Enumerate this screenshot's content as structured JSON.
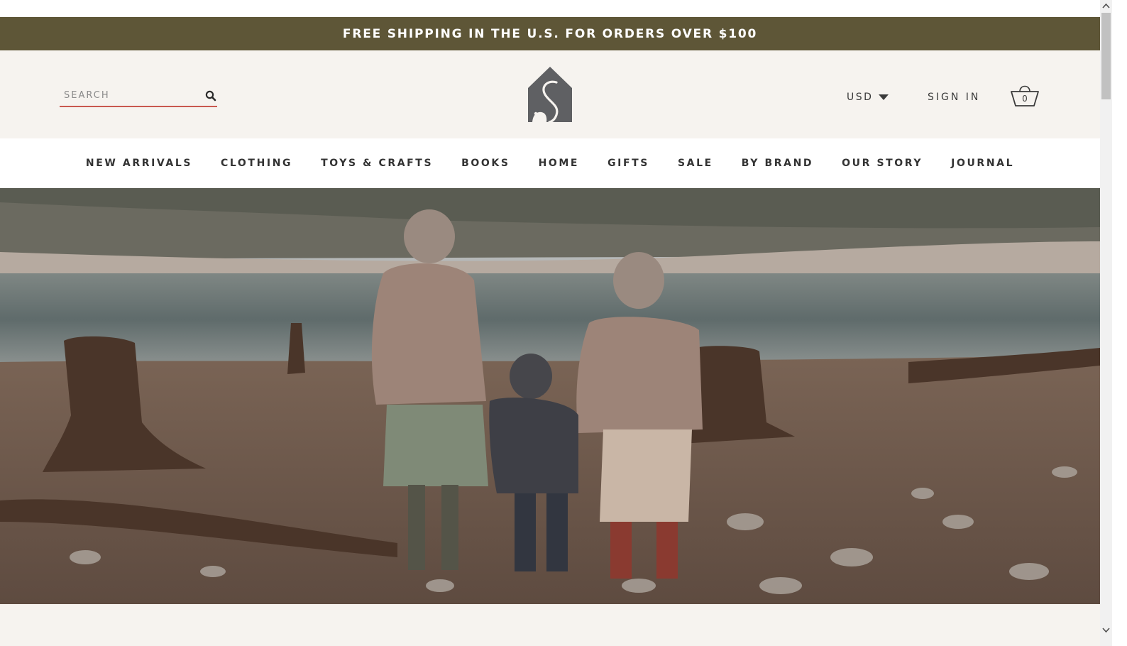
{
  "promo_bar": {
    "text": "FREE SHIPPING IN THE U.S. FOR ORDERS OVER $100"
  },
  "header": {
    "search": {
      "placeholder": "SEARCH",
      "value": ""
    },
    "currency": {
      "selected": "USD"
    },
    "sign_in_label": "SIGN IN",
    "cart_count": "0"
  },
  "nav": {
    "items": [
      {
        "label": "NEW ARRIVALS"
      },
      {
        "label": "CLOTHING"
      },
      {
        "label": "TOYS & CRAFTS"
      },
      {
        "label": "BOOKS"
      },
      {
        "label": "HOME"
      },
      {
        "label": "GIFTS"
      },
      {
        "label": "SALE"
      },
      {
        "label": "BY BRAND"
      },
      {
        "label": "OUR STORY"
      },
      {
        "label": "JOURNAL"
      }
    ]
  },
  "colors": {
    "promo_bg": "#5e5637",
    "header_bg": "#f6f3ef",
    "search_underline": "#c9584f",
    "text_dark": "#333333",
    "logo_gray": "#5f6063"
  },
  "icons": {
    "search": "search-icon",
    "currency_caret": "caret-down-icon",
    "cart": "basket-icon",
    "logo": "house-logo-icon"
  }
}
